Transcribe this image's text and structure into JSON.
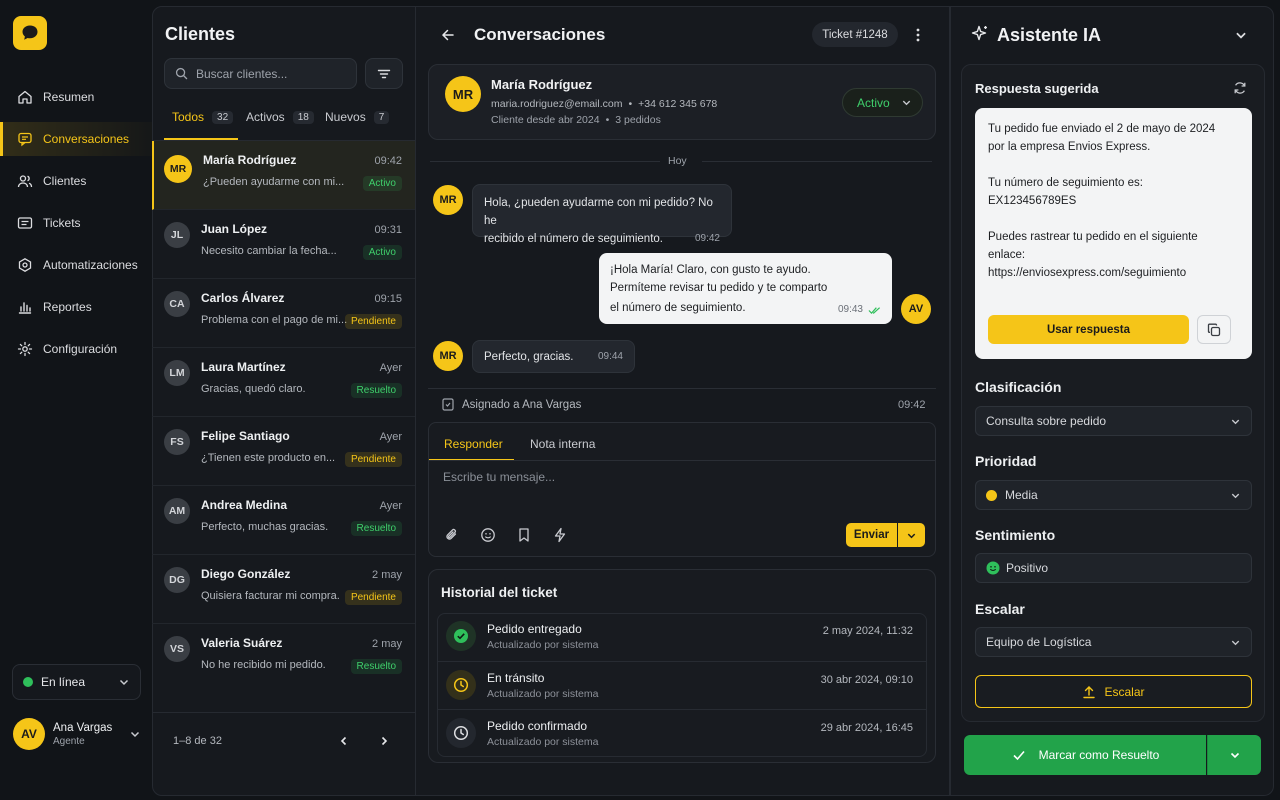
{
  "colors": {
    "accent": "#f5c518",
    "success": "#2fbf5b",
    "background": "#111418"
  },
  "nav": [
    {
      "label": "Resumen",
      "icon": "home-icon"
    },
    {
      "label": "Conversaciones",
      "icon": "chat-icon",
      "active": true
    },
    {
      "label": "Clientes",
      "icon": "users-icon"
    },
    {
      "label": "Tickets",
      "icon": "ticket-icon"
    },
    {
      "label": "Automatizaciones",
      "icon": "automation-icon"
    },
    {
      "label": "Reportes",
      "icon": "chart-icon"
    },
    {
      "label": "Configuración",
      "icon": "gear-icon"
    }
  ],
  "status": {
    "label": "En línea"
  },
  "user": {
    "initials": "AV",
    "name": "Ana Vargas",
    "role": "Agente"
  },
  "clients": {
    "title": "Clientes",
    "search_placeholder": "Buscar clientes...",
    "tabs": [
      {
        "label": "Todos",
        "count": "32"
      },
      {
        "label": "Activos",
        "count": "18"
      },
      {
        "label": "Nuevos",
        "count": "7"
      }
    ],
    "items": [
      {
        "initials": "MR",
        "name": "María Rodríguez",
        "time": "09:42",
        "message": "¿Pueden ayudarme con mi...",
        "status": "Activo"
      },
      {
        "initials": "JL",
        "name": "Juan López",
        "time": "09:31",
        "message": "Necesito cambiar la fecha...",
        "status": "Activo"
      },
      {
        "initials": "CA",
        "name": "Carlos Álvarez",
        "time": "09:15",
        "message": "Problema con el pago de mi...",
        "status": "Pendiente"
      },
      {
        "initials": "LM",
        "name": "Laura Martínez",
        "time": "Ayer",
        "message": "Gracias, quedó claro.",
        "status": "Resuelto"
      },
      {
        "initials": "FS",
        "name": "Felipe Santiago",
        "time": "Ayer",
        "message": "¿Tienen este producto en...",
        "status": "Pendiente"
      },
      {
        "initials": "AM",
        "name": "Andrea Medina",
        "time": "Ayer",
        "message": "Perfecto, muchas gracias.",
        "status": "Resuelto"
      },
      {
        "initials": "DG",
        "name": "Diego González",
        "time": "2 may",
        "message": "Quisiera facturar mi compra.",
        "status": "Pendiente"
      },
      {
        "initials": "VS",
        "name": "Valeria Suárez",
        "time": "2 may",
        "message": "No he recibido mi pedido.",
        "status": "Resuelto"
      }
    ],
    "pagination": "1–8 de 32"
  },
  "conversation": {
    "title": "Conversaciones",
    "ticket": "Ticket #1248",
    "contact": {
      "initials": "MR",
      "name": "María Rodríguez",
      "email": "maria.rodriguez@email.com",
      "phone": "+34 612 345 678",
      "since": "Cliente desde abr 2024",
      "orders": "3 pedidos",
      "status": "Activo"
    },
    "day_divider": "Hoy",
    "messages": [
      {
        "line1": "Hola, ¿pueden ayudarme con mi pedido? No he",
        "line2": "recibido el número de seguimiento.",
        "time": "09:42"
      },
      {
        "line1": "¡Hola María! Claro, con gusto te ayudo.",
        "line2": "Permíteme revisar tu pedido y te comparto",
        "line3": "el número de seguimiento.",
        "time": "09:43",
        "initials": "AV"
      },
      {
        "line1": "Perfecto, gracias.",
        "time": "09:44"
      }
    ],
    "assigned": "Asignado a Ana Vargas",
    "assigned_time": "09:42",
    "reply_tabs": [
      "Responder",
      "Nota interna"
    ],
    "reply_placeholder": "Escribe tu mensaje...",
    "send_label": "Enviar"
  },
  "history": {
    "title": "Historial del ticket",
    "items": [
      {
        "title": "Pedido entregado",
        "sub": "Actualizado por sistema",
        "date": "2 may 2024, 11:32"
      },
      {
        "title": "En tránsito",
        "sub": "Actualizado por sistema",
        "date": "30 abr 2024, 09:10"
      },
      {
        "title": "Pedido confirmado",
        "sub": "Actualizado por sistema",
        "date": "29 abr 2024, 16:45"
      }
    ]
  },
  "ai": {
    "title": "Asistente IA",
    "suggested_title": "Respuesta sugerida",
    "suggestion": {
      "p1a": "Tu pedido fue enviado el 2 de mayo de 2024",
      "p1b": "por la empresa Envios Express.",
      "p2a": "Tu número de seguimiento es:",
      "p2b": "EX123456789ES",
      "p3a": "Puedes rastrear tu pedido en el siguiente",
      "p3b": "enlace:",
      "p3c": "https://enviosexpress.com/seguimiento"
    },
    "use_label": "Usar respuesta",
    "classification_label": "Clasificación",
    "classification_value": "Consulta sobre pedido",
    "priority_label": "Prioridad",
    "priority_value": "Media",
    "sentiment_label": "Sentimiento",
    "sentiment_value": "Positivo",
    "escalate_label": "Escalar",
    "escalate_value": "Equipo de Logística",
    "escalate_button": "Escalar",
    "resolve_button": "Marcar como Resuelto"
  }
}
